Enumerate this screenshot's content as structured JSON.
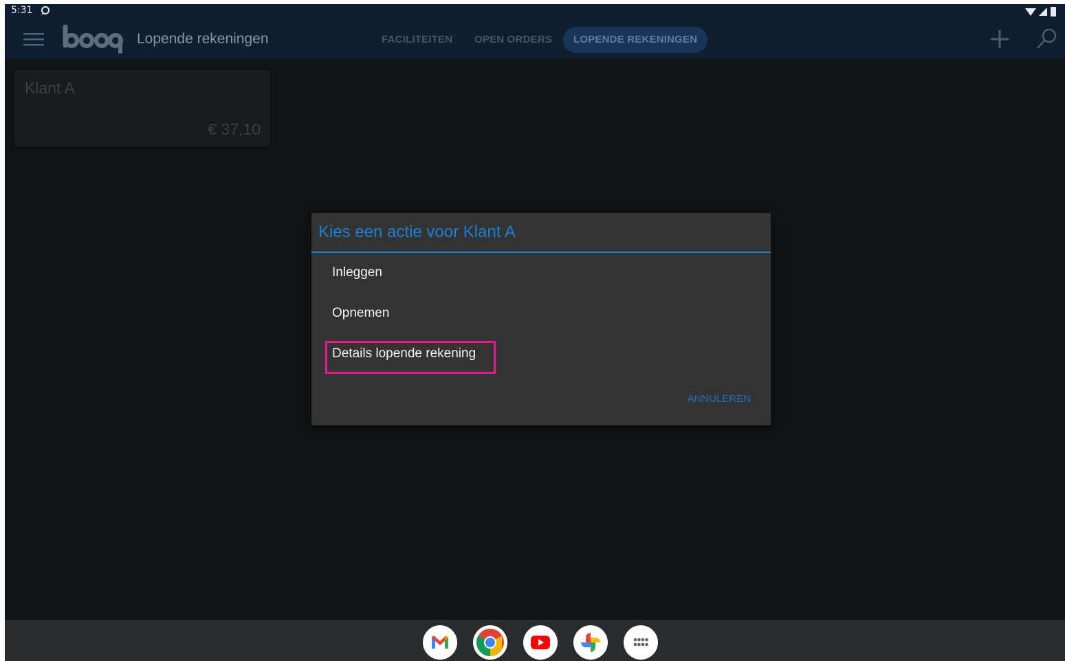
{
  "status_bar": {
    "time": "5:31"
  },
  "app_bar": {
    "logo_text": "booq",
    "title": "Lopende rekeningen",
    "tabs": [
      {
        "label": "FACILITEITEN",
        "active": false
      },
      {
        "label": "OPEN ORDERS",
        "active": false
      },
      {
        "label": "LOPENDE REKENINGEN",
        "active": true
      }
    ],
    "actions": [
      "add-icon",
      "search-icon"
    ]
  },
  "accounts": [
    {
      "name": "Klant A",
      "amount": "€ 37,10"
    }
  ],
  "dialog": {
    "title": "Kies een actie voor Klant A",
    "items": [
      {
        "label": "Inleggen"
      },
      {
        "label": "Opnemen"
      },
      {
        "label": "Details lopende rekening",
        "highlighted": true
      }
    ],
    "cancel_label": "ANNULEREN"
  },
  "dock": {
    "apps": [
      "gmail-icon",
      "chrome-icon",
      "youtube-icon",
      "photos-icon",
      "app-drawer-icon"
    ]
  },
  "colors": {
    "accent": "#1d7fd4",
    "highlight": "#e41b8f",
    "appbar": "#0f1f30",
    "dialog": "#333333"
  }
}
